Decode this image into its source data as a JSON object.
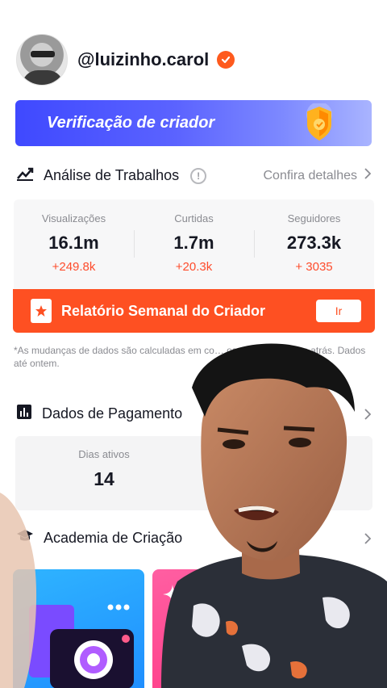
{
  "profile": {
    "handle": "@luizinho.carol",
    "verified_icon": "verified-badge-icon",
    "colors": {
      "accent": "#fe5a1d"
    }
  },
  "banner": {
    "label": "Verificação de criador",
    "icon": "shield-icon"
  },
  "work_analysis": {
    "title": "Análise de Trabalhos",
    "details_label": "Confira detalhes",
    "stats": [
      {
        "label": "Visualizações",
        "value": "16.1m",
        "delta": "+249.8k"
      },
      {
        "label": "Curtidas",
        "value": "1.7m",
        "delta": "+20.3k"
      },
      {
        "label": "Seguidores",
        "value": "273.3k",
        "delta": "+ 3035"
      }
    ]
  },
  "weekly_report": {
    "label": "Relatório Semanal do Criador",
    "button": "Ir"
  },
  "footnote": "*As mudanças de dados são calculadas em co…                                  os dados de 7 dias atrás. Dados até ontem.",
  "payment": {
    "title": "Dados de Pagamento",
    "active_days_label": "Dias ativos",
    "active_days_value": "14"
  },
  "academy": {
    "title": "Academia de Criação"
  }
}
